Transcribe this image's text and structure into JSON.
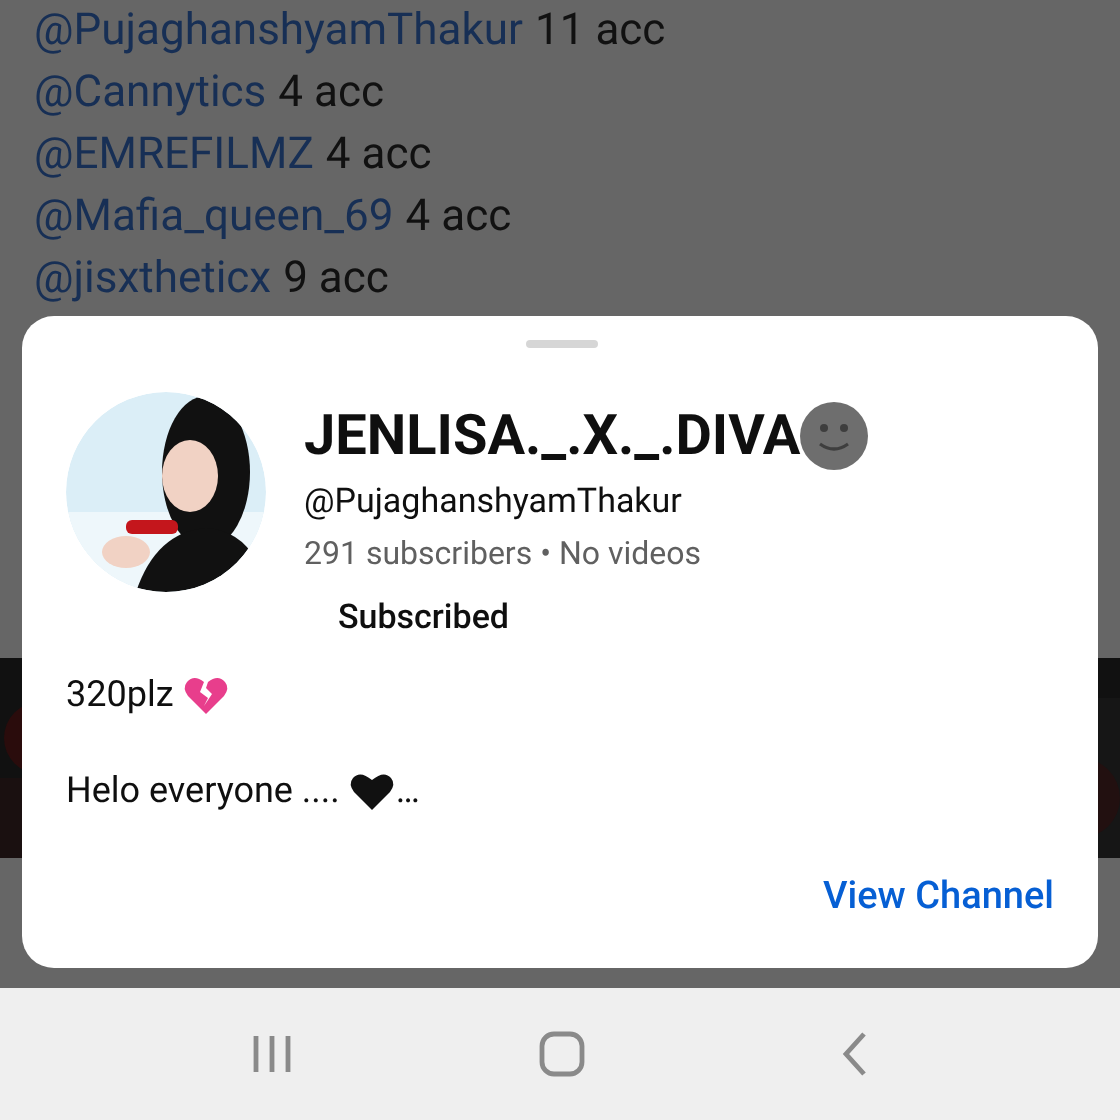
{
  "mention_list": [
    {
      "handle": "@PujaghanshyamThakur",
      "count": "11 acc"
    },
    {
      "handle": "@Cannytics",
      "count": "4 acc"
    },
    {
      "handle": "@EMREFILMZ",
      "count": "4 acc"
    },
    {
      "handle": "@Mafia_queen_69",
      "count": "4 acc"
    },
    {
      "handle": "@jisxtheticx",
      "count": "9 acc"
    }
  ],
  "channel_card": {
    "name": "JENLISA._.X._.DIVA",
    "handle": "@PujaghanshyamThakur",
    "stats": "291 subscribers • No videos",
    "subscribe_button": "Subscribed",
    "description": [
      {
        "text": "320plz",
        "kind": "broken-heart"
      },
      {
        "text": "Helo everyone ....",
        "kind": "black-heart",
        "after": "…"
      }
    ],
    "action": "View Channel"
  }
}
